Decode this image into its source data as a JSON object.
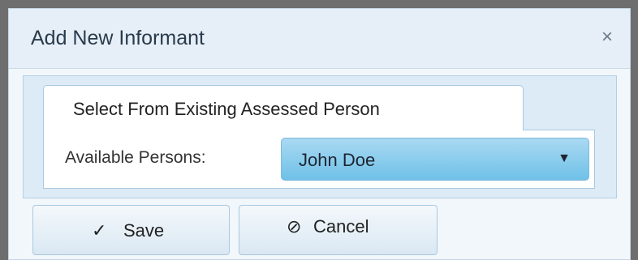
{
  "dialog": {
    "title": "Add New Informant",
    "close_glyph": "×",
    "close_icon": "close-icon"
  },
  "tabs": [
    {
      "label": "Select From Existing Assessed Person",
      "active": true
    }
  ],
  "form": {
    "available_persons_label": "Available Persons:",
    "available_persons_value": "John Doe",
    "dropdown_icon": "caret-down-icon",
    "dropdown_glyph": "▼"
  },
  "actions": {
    "save_label": "Save",
    "save_icon": "checkmark-icon",
    "save_glyph": "✓",
    "cancel_label": "Cancel",
    "cancel_icon": "ban-icon",
    "cancel_glyph": "⊘"
  },
  "colors": {
    "select_accent": "#6fc1e8",
    "title_bar": "#e6eff7",
    "border": "#a9c8e0"
  }
}
